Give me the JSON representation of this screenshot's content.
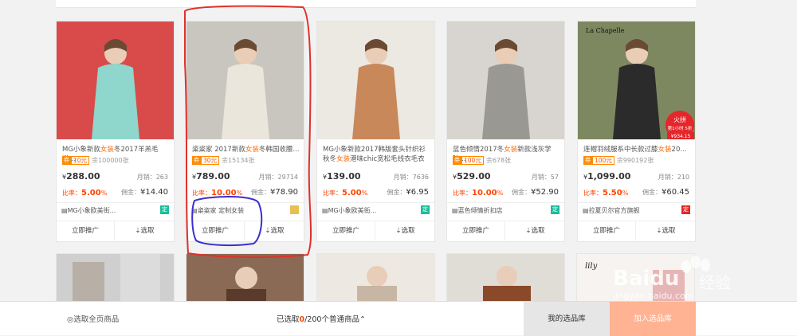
{
  "footer": {
    "select_all": "选取全页商品",
    "selected_prefix": "已选取",
    "selected_count": "0",
    "selected_suffix": "/200个普通商品",
    "my_library": "我的选品库",
    "add_library": "加入选品库"
  },
  "watermark": {
    "brand": "Bai",
    "brand2": "du",
    "jingyan": "经验",
    "url": "jingyan.baidu.com"
  },
  "colors": {
    "accent": "#ff4400",
    "coupon": "#ff8a00",
    "annot_red": "#e0302a",
    "annot_blue": "#3a2fd0"
  },
  "products": [
    {
      "title_pre": "MG小象新款",
      "title_hl": "女装",
      "title_post": "冬2017羊羔毛学...",
      "coupon_tag": "券",
      "coupon_val": "10元",
      "coupon_left": "余100000张",
      "price": "288.00",
      "sales": "月销：263",
      "rate_label": "比率：",
      "rate": "5.00",
      "rate_unit": "%",
      "comm_label": "佣金：",
      "comm": "¥14.40",
      "shop": "MG小象欧美街...",
      "badge": "定",
      "badge_color": "#1bbc9b"
    },
    {
      "title_pre": "粢粢家 2017新款",
      "title_hl": "女装",
      "title_post": "冬韩国收腰...",
      "coupon_tag": "券",
      "coupon_val": "30元",
      "coupon_left": "余15134张",
      "price": "789.00",
      "sales": "月销：29714",
      "rate_label": "比率：",
      "rate": "10.00",
      "rate_unit": "%",
      "comm_label": "佣金：",
      "comm": "¥78.90",
      "shop": "粢粢家 定制女装",
      "badge": "",
      "badge_color": "#e8c050"
    },
    {
      "title_pre": "MG小象新款2017韩版套头针织衫秋冬",
      "title_hl": "女装",
      "title_post": "港味chic宽松毛线衣毛衣团",
      "coupon_tag": "",
      "coupon_val": "",
      "coupon_left": "",
      "price": "139.00",
      "sales": "月销：7636",
      "rate_label": "比率：",
      "rate": "5.00",
      "rate_unit": "%",
      "comm_label": "佣金：",
      "comm": "¥6.95",
      "shop": "MG小象欧美街...",
      "badge": "定",
      "badge_color": "#1bbc9b"
    },
    {
      "title_pre": "蓝色倾情2017冬",
      "title_hl": "女装",
      "title_post": "新款浅灰学院...",
      "coupon_tag": "券",
      "coupon_val": "100元",
      "coupon_left": "余678张",
      "price": "529.00",
      "sales": "月销：57",
      "rate_label": "比率：",
      "rate": "10.00",
      "rate_unit": "%",
      "comm_label": "佣金：",
      "comm": "¥52.90",
      "shop": "蓝色倾情折扣店",
      "badge": "定",
      "badge_color": "#1bbc9b"
    },
    {
      "title_pre": "连帽羽绒服系中长款过膝",
      "title_hl": "女装",
      "title_post": "20...",
      "coupon_tag": "券",
      "coupon_val": "100元",
      "coupon_left": "余990192张",
      "price": "1,099.00",
      "sales": "月销：210",
      "rate_label": "比率：",
      "rate": "5.50",
      "rate_unit": "%",
      "comm_label": "佣金：",
      "comm": "¥60.45",
      "shop": "拉夏贝尔官方旗舰",
      "badge": "定",
      "badge_color": "#e5262a"
    }
  ],
  "card_buttons": {
    "promote": "立即推广",
    "select": "选取"
  },
  "images": [
    {
      "label": "",
      "bg": "#d94b4b",
      "coat": "#8fd6cc"
    },
    {
      "label": "",
      "bg": "#c9c6c0",
      "coat": "#eae6dc"
    },
    {
      "label": "",
      "bg": "#ece8e2",
      "coat": "#c9885a"
    },
    {
      "label": "",
      "bg": "#d8d4cf",
      "coat": "#9a9893"
    },
    {
      "label": "La Chapelle",
      "bg": "#7e8860",
      "coat": "#2b2b2b",
      "promo": "火拼",
      "promo_sub": "第1小时 5折",
      "promo_price": "¥934.15"
    }
  ]
}
